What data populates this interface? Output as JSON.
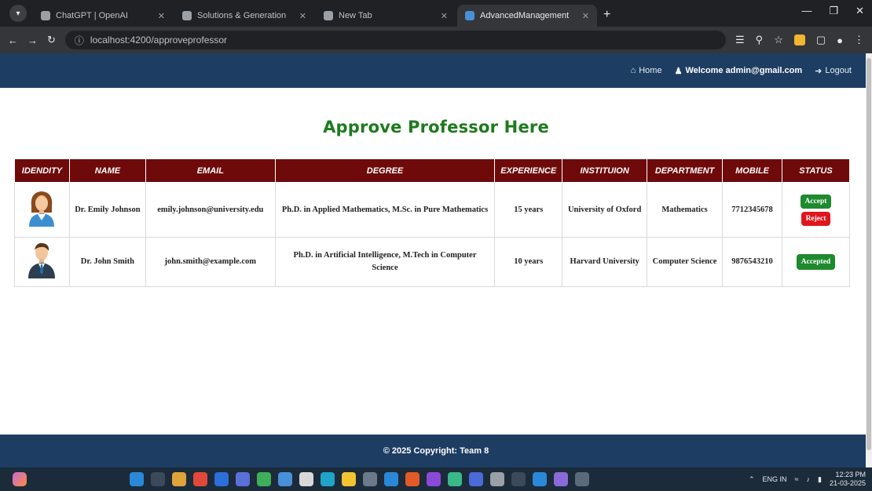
{
  "browser": {
    "tabs": [
      {
        "title": "ChatGPT | OpenAI",
        "active": false
      },
      {
        "title": "Solutions & Generation",
        "active": false
      },
      {
        "title": "New Tab",
        "active": false
      },
      {
        "title": "AdvancedManagement",
        "active": true
      }
    ],
    "url": "localhost:4200/approveprofessor",
    "new_tab_glyph": "+"
  },
  "header": {
    "home_label": "Home",
    "welcome_label": "Welcome admin@gmail.com",
    "logout_label": "Logout"
  },
  "page_title": "Approve Professor Here",
  "table": {
    "columns": [
      "IDENDITY",
      "NAME",
      "EMAIL",
      "DEGREE",
      "EXPERIENCE",
      "INSTITUION",
      "DEPARTMENT",
      "MOBILE",
      "STATUS"
    ],
    "rows": [
      {
        "avatar": "female-avatar-icon",
        "name": "Dr. Emily Johnson",
        "email": "emily.johnson@university.edu",
        "degree": "Ph.D. in Applied Mathematics, M.Sc. in Pure Mathematics",
        "experience": "15 years",
        "institution": "University of Oxford",
        "department": "Mathematics",
        "mobile": "7712345678",
        "accept_label": "Accept",
        "reject_label": "Reject"
      },
      {
        "avatar": "male-avatar-icon",
        "name": "Dr. John Smith",
        "email": "john.smith@example.com",
        "degree": "Ph.D. in Artificial Intelligence, M.Tech in Computer Science",
        "experience": "10 years",
        "institution": "Harvard University",
        "department": "Computer Science",
        "mobile": "9876543210",
        "status_label": "Accepted"
      }
    ]
  },
  "footer": {
    "text": "© 2025 Copyright: Team 8"
  },
  "taskbar": {
    "lang": "ENG IN",
    "time": "12:23 PM",
    "date": "21-03-2025"
  },
  "colors": {
    "header_bg": "#1d3d63",
    "table_header_bg": "#6e0a0a",
    "title_green": "#1e7a1e",
    "accept_green": "#1e8a2e",
    "reject_red": "#e0161c"
  }
}
